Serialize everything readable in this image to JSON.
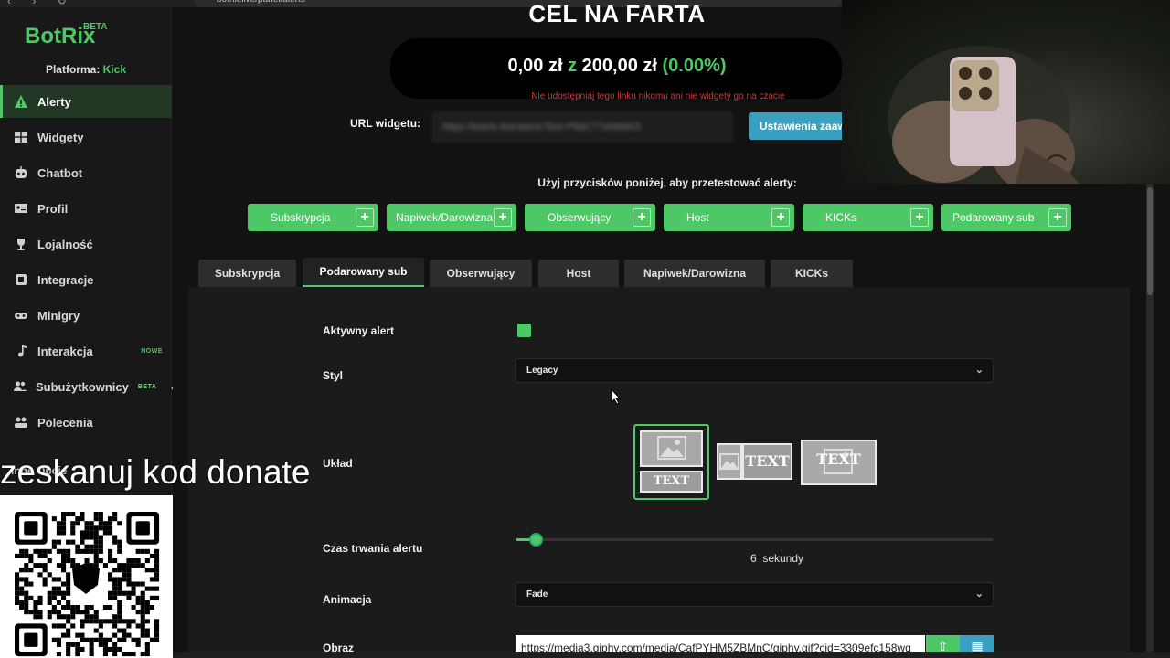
{
  "browser": {
    "url": "botrix.live/panel/alerts",
    "nav_glyphs": "‹ › ↻"
  },
  "sidebar": {
    "logo": "BotRix",
    "logo_badge": "BETA",
    "platform_label": "Platforma:",
    "platform_value": "Kick",
    "items": [
      {
        "label": "Alerty",
        "icon": "warning-icon",
        "active": true
      },
      {
        "label": "Widgety",
        "icon": "grid-icon"
      },
      {
        "label": "Chatbot",
        "icon": "robot-icon"
      },
      {
        "label": "Profil",
        "icon": "id-card-icon"
      },
      {
        "label": "Lojalność",
        "icon": "trophy-icon"
      },
      {
        "label": "Integracje",
        "icon": "plug-icon"
      },
      {
        "label": "Minigry",
        "icon": "gamepad-icon"
      },
      {
        "label": "Interakcja",
        "icon": "music-icon",
        "badge": "NOWE"
      },
      {
        "label": "Subużytkownicy",
        "icon": "users-icon",
        "badge": "BETA"
      },
      {
        "label": "Polecenia",
        "icon": "people-icon"
      }
    ],
    "other_heading": "Inne Opcje"
  },
  "goal": {
    "title": "CEL NA FARTA",
    "current": "0,00 zł",
    "connector": "z",
    "target": "200,00 zł",
    "percent": "(0.00%)",
    "warning": "Nie udostępniaj tego linku nikomu ani nie widgety go na czacie"
  },
  "widget": {
    "url_label": "URL widgetu:",
    "url_value": "https://botrix.live/alerts?bid=PbbC77eMekK5",
    "settings_button": "Ustawienia zaaw"
  },
  "test": {
    "hint": "Użyj przycisków poniżej, aby przetestować alerty:",
    "buttons": [
      "Subskrypcja",
      "Napiwek/Darowizna",
      "Obserwujący",
      "Host",
      "KICKs",
      "Podarowany sub"
    ]
  },
  "tabs": [
    "Subskrypcja",
    "Podarowany sub",
    "Obserwujący",
    "Host",
    "Napiwek/Darowizna",
    "KICKs"
  ],
  "active_tab": "Podarowany sub",
  "form": {
    "active_label": "Aktywny alert",
    "active_checked": true,
    "style_label": "Styl",
    "style_value": "Legacy",
    "layout_label": "Układ",
    "layout_text": "TEXT",
    "duration_label": "Czas trwania alertu",
    "duration_value": "6",
    "duration_unit": "sekundy",
    "duration_fraction": 0.04,
    "animation_label": "Animacja",
    "animation_value": "Fade",
    "image_label": "Obraz",
    "image_value": "https://media3.giphy.com/media/CafPYHM5ZBMnC/giphy.gif?cid=3309efc158wq"
  },
  "overlay": {
    "donate_text": "zeskanuj kod donate"
  },
  "colors": {
    "accent": "#4ec866",
    "info": "#39a0c0",
    "warning": "#d23a3a"
  }
}
